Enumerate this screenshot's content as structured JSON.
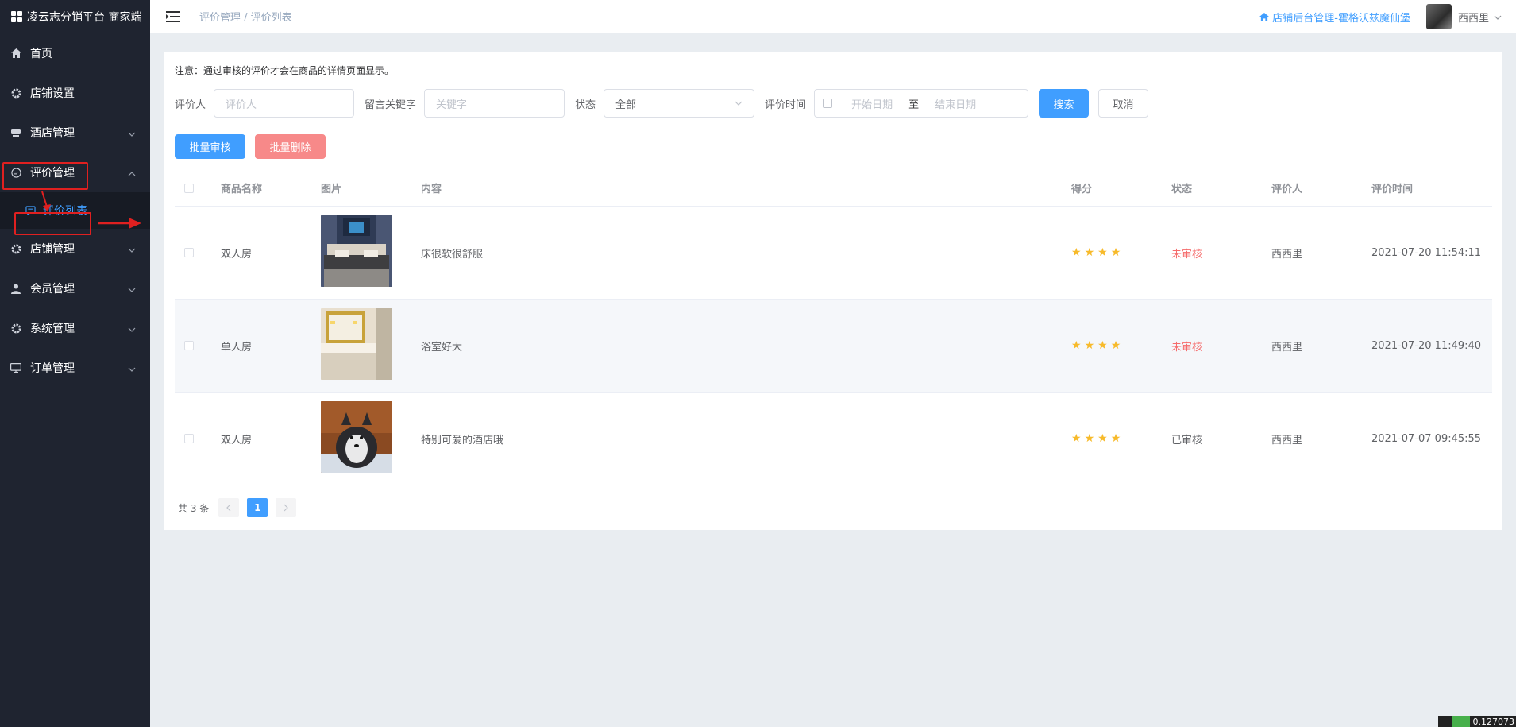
{
  "sidebar": {
    "brand": "凌云志分销平台 商家端",
    "items": [
      {
        "label": "首页",
        "icon": "home-icon"
      },
      {
        "label": "店铺设置",
        "icon": "gear-icon"
      },
      {
        "label": "酒店管理",
        "icon": "hotel-icon"
      },
      {
        "label": "评价管理",
        "icon": "comment-icon"
      },
      {
        "label": "店铺管理",
        "icon": "gear-icon"
      },
      {
        "label": "会员管理",
        "icon": "user-icon"
      },
      {
        "label": "系统管理",
        "icon": "gear-icon"
      },
      {
        "label": "订单管理",
        "icon": "monitor-icon"
      }
    ],
    "sub_item": {
      "label": "评价列表",
      "icon": "comment-icon"
    }
  },
  "header": {
    "breadcrumb": "评价管理 / 评价列表",
    "store_link": "店铺后台管理-霍格沃兹魔仙堡",
    "username": "西西里"
  },
  "notice": "注意：通过审核的评价才会在商品的详情页面显示。",
  "filters": {
    "reviewer_label": "评价人",
    "reviewer_placeholder": "评价人",
    "keyword_label": "留言关键字",
    "keyword_placeholder": "关键字",
    "status_label": "状态",
    "status_value": "全部",
    "time_label": "评价时间",
    "start_placeholder": "开始日期",
    "date_sep": "至",
    "end_placeholder": "结束日期",
    "search_btn": "搜索",
    "cancel_btn": "取消"
  },
  "batch": {
    "approve_btn": "批量审核",
    "delete_btn": "批量删除"
  },
  "table": {
    "headers": [
      "商品名称",
      "图片",
      "内容",
      "得分",
      "状态",
      "评价人",
      "评价时间"
    ],
    "rows": [
      {
        "name": "双人房",
        "content": "床很软很舒服",
        "stars": 4,
        "status": "未审核",
        "reviewer": "西西里",
        "time": "2021-07-20 11:54:11"
      },
      {
        "name": "单人房",
        "content": "浴室好大",
        "stars": 4,
        "status": "未审核",
        "reviewer": "西西里",
        "time": "2021-07-20 11:49:40"
      },
      {
        "name": "双人房",
        "content": "特别可爱的酒店哦",
        "stars": 4,
        "status": "已审核",
        "reviewer": "西西里",
        "time": "2021-07-07 09:45:55"
      }
    ]
  },
  "pagination": {
    "total": "共 3 条",
    "current": "1"
  },
  "corner": "0.127073"
}
